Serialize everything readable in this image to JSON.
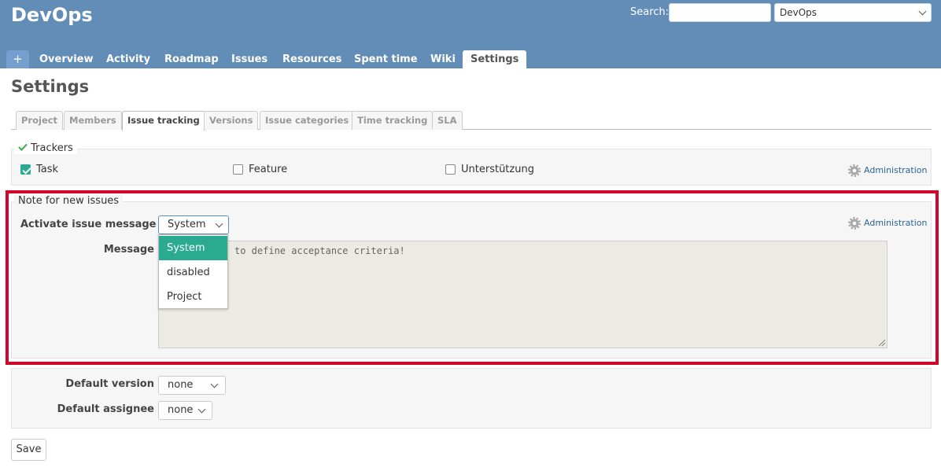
{
  "header": {
    "project_title": "DevOps",
    "search_label": "Search:",
    "search_value": "",
    "project_jump_value": "DevOps"
  },
  "main_menu": {
    "new_label": "+",
    "items": [
      "Overview",
      "Activity",
      "Roadmap",
      "Issues",
      "Resources",
      "Spent time",
      "Wiki",
      "Settings"
    ],
    "selected": "Settings"
  },
  "page_title": "Settings",
  "tabs": {
    "items": [
      "Project",
      "Members",
      "Issue tracking",
      "Versions",
      "Issue categories",
      "Time tracking",
      "SLA"
    ],
    "selected": "Issue tracking"
  },
  "trackers": {
    "legend": "Trackers",
    "items": [
      {
        "label": "Task",
        "checked": true
      },
      {
        "label": "Feature",
        "checked": false
      },
      {
        "label": "Unterstützung",
        "checked": false
      }
    ],
    "admin_link": "Administration"
  },
  "note": {
    "legend": "Note for new issues",
    "activate_label": "Activate issue message",
    "activate_value": "System",
    "message_label": "Message",
    "message_text": "to define acceptance criteria!",
    "admin_link": "Administration",
    "dropdown_options": [
      "System",
      "disabled",
      "Project"
    ],
    "dropdown_selected": "System"
  },
  "defaults": {
    "version_label": "Default version",
    "version_value": "none",
    "assignee_label": "Default assignee",
    "assignee_value": "none"
  },
  "save_label": "Save",
  "colors": {
    "header_bg": "#628db6",
    "accent": "#2aab8f",
    "highlight_border": "#d2062a"
  }
}
